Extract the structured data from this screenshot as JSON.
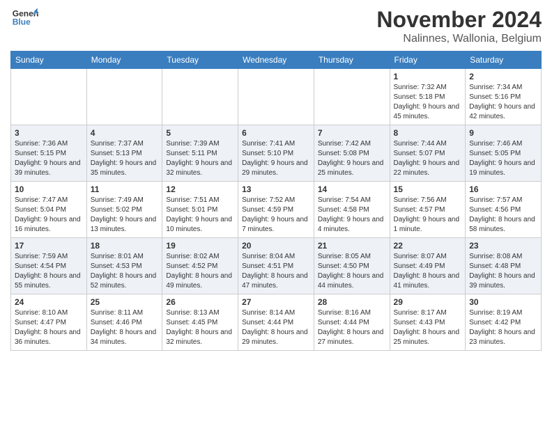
{
  "header": {
    "logo_general": "General",
    "logo_blue": "Blue",
    "month_title": "November 2024",
    "location": "Nalinnes, Wallonia, Belgium"
  },
  "days_of_week": [
    "Sunday",
    "Monday",
    "Tuesday",
    "Wednesday",
    "Thursday",
    "Friday",
    "Saturday"
  ],
  "weeks": [
    [
      {
        "day": "",
        "info": ""
      },
      {
        "day": "",
        "info": ""
      },
      {
        "day": "",
        "info": ""
      },
      {
        "day": "",
        "info": ""
      },
      {
        "day": "",
        "info": ""
      },
      {
        "day": "1",
        "info": "Sunrise: 7:32 AM\nSunset: 5:18 PM\nDaylight: 9 hours and 45 minutes."
      },
      {
        "day": "2",
        "info": "Sunrise: 7:34 AM\nSunset: 5:16 PM\nDaylight: 9 hours and 42 minutes."
      }
    ],
    [
      {
        "day": "3",
        "info": "Sunrise: 7:36 AM\nSunset: 5:15 PM\nDaylight: 9 hours and 39 minutes."
      },
      {
        "day": "4",
        "info": "Sunrise: 7:37 AM\nSunset: 5:13 PM\nDaylight: 9 hours and 35 minutes."
      },
      {
        "day": "5",
        "info": "Sunrise: 7:39 AM\nSunset: 5:11 PM\nDaylight: 9 hours and 32 minutes."
      },
      {
        "day": "6",
        "info": "Sunrise: 7:41 AM\nSunset: 5:10 PM\nDaylight: 9 hours and 29 minutes."
      },
      {
        "day": "7",
        "info": "Sunrise: 7:42 AM\nSunset: 5:08 PM\nDaylight: 9 hours and 25 minutes."
      },
      {
        "day": "8",
        "info": "Sunrise: 7:44 AM\nSunset: 5:07 PM\nDaylight: 9 hours and 22 minutes."
      },
      {
        "day": "9",
        "info": "Sunrise: 7:46 AM\nSunset: 5:05 PM\nDaylight: 9 hours and 19 minutes."
      }
    ],
    [
      {
        "day": "10",
        "info": "Sunrise: 7:47 AM\nSunset: 5:04 PM\nDaylight: 9 hours and 16 minutes."
      },
      {
        "day": "11",
        "info": "Sunrise: 7:49 AM\nSunset: 5:02 PM\nDaylight: 9 hours and 13 minutes."
      },
      {
        "day": "12",
        "info": "Sunrise: 7:51 AM\nSunset: 5:01 PM\nDaylight: 9 hours and 10 minutes."
      },
      {
        "day": "13",
        "info": "Sunrise: 7:52 AM\nSunset: 4:59 PM\nDaylight: 9 hours and 7 minutes."
      },
      {
        "day": "14",
        "info": "Sunrise: 7:54 AM\nSunset: 4:58 PM\nDaylight: 9 hours and 4 minutes."
      },
      {
        "day": "15",
        "info": "Sunrise: 7:56 AM\nSunset: 4:57 PM\nDaylight: 9 hours and 1 minute."
      },
      {
        "day": "16",
        "info": "Sunrise: 7:57 AM\nSunset: 4:56 PM\nDaylight: 8 hours and 58 minutes."
      }
    ],
    [
      {
        "day": "17",
        "info": "Sunrise: 7:59 AM\nSunset: 4:54 PM\nDaylight: 8 hours and 55 minutes."
      },
      {
        "day": "18",
        "info": "Sunrise: 8:01 AM\nSunset: 4:53 PM\nDaylight: 8 hours and 52 minutes."
      },
      {
        "day": "19",
        "info": "Sunrise: 8:02 AM\nSunset: 4:52 PM\nDaylight: 8 hours and 49 minutes."
      },
      {
        "day": "20",
        "info": "Sunrise: 8:04 AM\nSunset: 4:51 PM\nDaylight: 8 hours and 47 minutes."
      },
      {
        "day": "21",
        "info": "Sunrise: 8:05 AM\nSunset: 4:50 PM\nDaylight: 8 hours and 44 minutes."
      },
      {
        "day": "22",
        "info": "Sunrise: 8:07 AM\nSunset: 4:49 PM\nDaylight: 8 hours and 41 minutes."
      },
      {
        "day": "23",
        "info": "Sunrise: 8:08 AM\nSunset: 4:48 PM\nDaylight: 8 hours and 39 minutes."
      }
    ],
    [
      {
        "day": "24",
        "info": "Sunrise: 8:10 AM\nSunset: 4:47 PM\nDaylight: 8 hours and 36 minutes."
      },
      {
        "day": "25",
        "info": "Sunrise: 8:11 AM\nSunset: 4:46 PM\nDaylight: 8 hours and 34 minutes."
      },
      {
        "day": "26",
        "info": "Sunrise: 8:13 AM\nSunset: 4:45 PM\nDaylight: 8 hours and 32 minutes."
      },
      {
        "day": "27",
        "info": "Sunrise: 8:14 AM\nSunset: 4:44 PM\nDaylight: 8 hours and 29 minutes."
      },
      {
        "day": "28",
        "info": "Sunrise: 8:16 AM\nSunset: 4:44 PM\nDaylight: 8 hours and 27 minutes."
      },
      {
        "day": "29",
        "info": "Sunrise: 8:17 AM\nSunset: 4:43 PM\nDaylight: 8 hours and 25 minutes."
      },
      {
        "day": "30",
        "info": "Sunrise: 8:19 AM\nSunset: 4:42 PM\nDaylight: 8 hours and 23 minutes."
      }
    ]
  ]
}
